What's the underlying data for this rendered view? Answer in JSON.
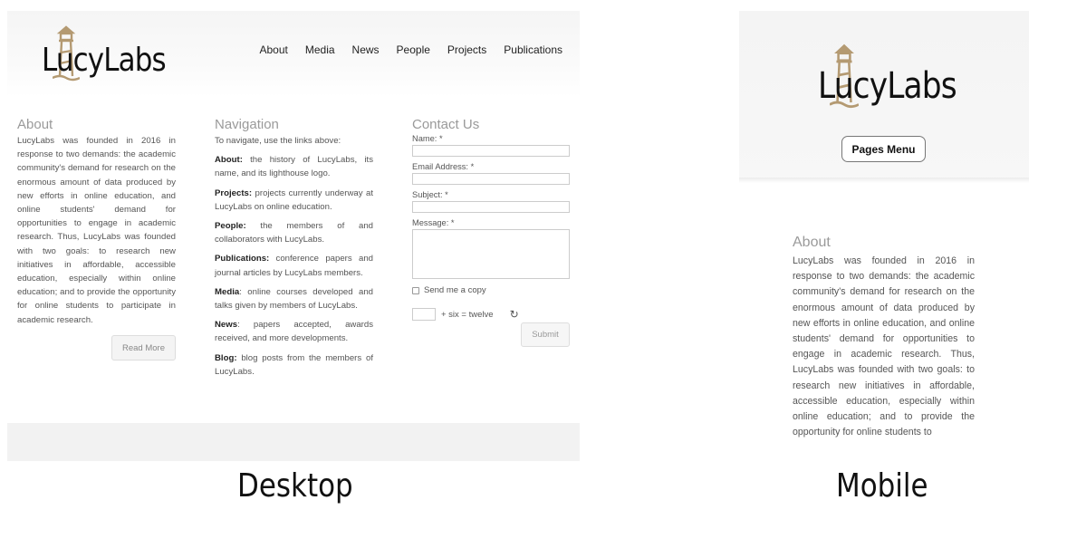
{
  "desktop": {
    "logo_text": "LucyLabs",
    "nav": [
      "About",
      "Media",
      "News",
      "People",
      "Projects",
      "Publications"
    ],
    "about": {
      "heading": "About",
      "body": "LucyLabs was founded in 2016 in response to two demands: the academic community's demand for research on the enormous amount of data produced by new efforts in online education, and online students' demand for opportunities to engage in academic research. Thus, LucyLabs was founded with two goals: to research new initiatives in affordable, accessible education, especially within online education; and to provide the opportunity for online students to participate in academic research.",
      "read_more": "Read More"
    },
    "navigation": {
      "heading": "Navigation",
      "intro": "To navigate, use the links above:",
      "entries": [
        {
          "term": "About:",
          "desc": " the history of LucyLabs, its name, and its lighthouse logo."
        },
        {
          "term": "Projects:",
          "desc": " projects currently underway at LucyLabs on online education."
        },
        {
          "term": "People:",
          "desc": " the members of and collaborators with LucyLabs."
        },
        {
          "term": "Publications:",
          "desc": " conference papers and journal articles by LucyLabs members."
        },
        {
          "term": "Media",
          "desc": ": online courses developed and talks given by members of LucyLabs."
        },
        {
          "term": "News",
          "desc": ": papers accepted, awards received, and more developments."
        },
        {
          "term": "Blog:",
          "desc": " blog posts from the members of LucyLabs."
        }
      ]
    },
    "contact": {
      "heading": "Contact Us",
      "name_label": "Name: *",
      "email_label": "Email Address: *",
      "subject_label": "Subject: *",
      "message_label": "Message: *",
      "copy_label": "Send me a copy",
      "captcha_text": "+ six = twelve",
      "submit": "Submit"
    }
  },
  "mobile": {
    "logo_text": "LucyLabs",
    "pages_menu": "Pages Menu",
    "about_heading": "About",
    "about_body": "LucyLabs was founded in 2016 in response to two demands: the academic community's demand for research on the enormous amount of data produced by new efforts in online education, and online students' demand for opportunities to engage in academic research. Thus, LucyLabs was founded with two goals: to research new initiatives in affordable, accessible education, especially within online education; and to provide the opportunity for online students to"
  },
  "captions": {
    "desktop": "Desktop",
    "mobile": "Mobile"
  },
  "colors": {
    "logo_tower": "#b49a72",
    "heading_gray": "#9a9a9a",
    "footer_gray": "#f2f2f2"
  },
  "icons": {
    "logo": "lighthouse-icon",
    "captcha_refresh": "refresh-icon",
    "checkbox": "checkbox-icon"
  }
}
